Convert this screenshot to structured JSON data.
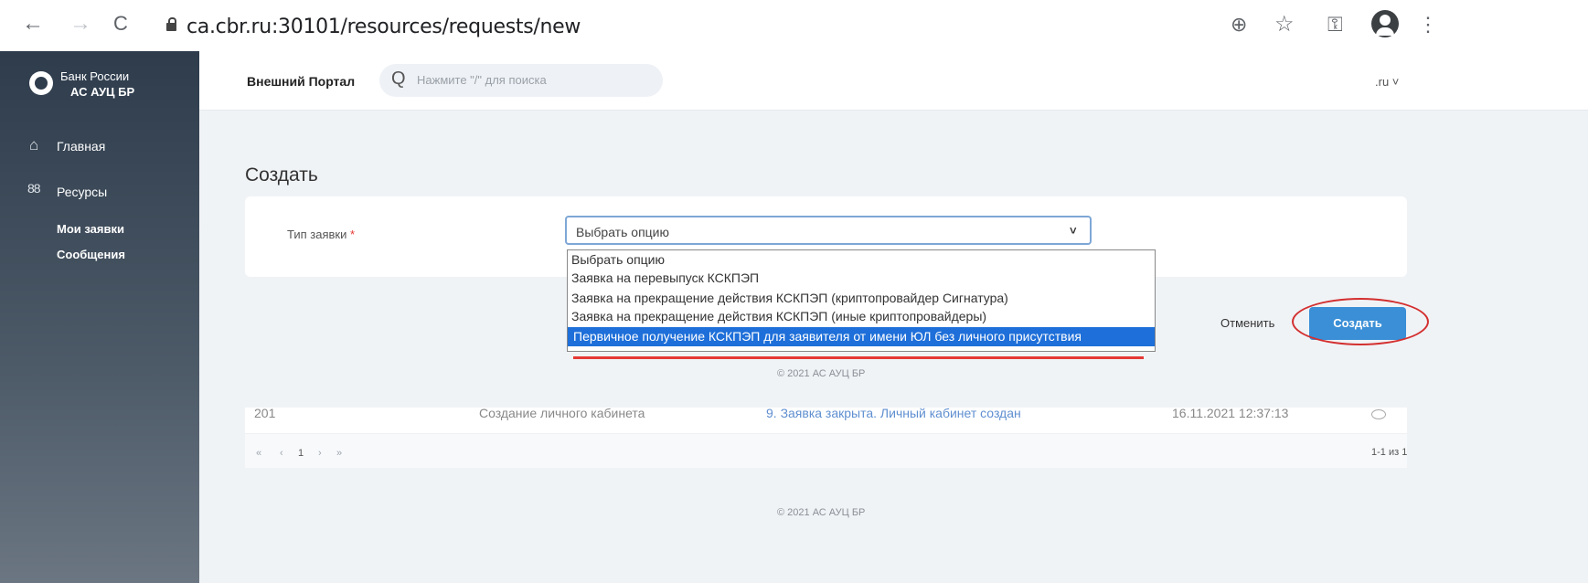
{
  "browser": {
    "url": "ca.cbr.ru:30101/resources/requests/new",
    "back_icon": "←",
    "forward_icon": "→",
    "reload_icon": "C",
    "zoom_icon": "⊕",
    "star_icon": "☆",
    "key_icon": "⚿",
    "menu_icon": "⋮"
  },
  "sidebar": {
    "logo_line1": "Банк России",
    "logo_line2": "АС АУЦ БР",
    "nav": [
      {
        "label": "Главная",
        "icon": "⌂"
      },
      {
        "label": "Ресурсы",
        "icon": "88"
      }
    ],
    "sub": [
      "Мои заявки",
      "Сообщения"
    ]
  },
  "header": {
    "portal": "Внешний Портал",
    "search_placeholder": "Нажмите \"/\" для поиска",
    "search_icon": "Q",
    "lang": ".ru ˅"
  },
  "main": {
    "title": "Создать",
    "field_label": "Тип заявки",
    "required_mark": "*",
    "select_value": "Выбрать опцию",
    "select_chevron": "˅",
    "options": [
      "Выбрать опцию",
      "Заявка на перевыпуск КСКПЭП",
      "Заявка на прекращение действия КСКПЭП (криптопровайдер Сигнатура)",
      "Заявка на прекращение действия КСКПЭП (иные криптопровайдеры)",
      "Первичное получение КСКПЭП для заявителя от имени ЮЛ без личного присутствия"
    ],
    "cancel": "Отменить",
    "create": "Создать",
    "copyright": "© 2021 АС АУЦ БР"
  },
  "table": {
    "row": [
      "201",
      "Создание личного кабинета",
      "9. Заявка закрыта. Личный кабинет создан",
      "16.11.2021 12:37:13"
    ],
    "pager": [
      "«",
      "‹",
      "1",
      "›",
      "»"
    ],
    "count": "1-1 из 1"
  },
  "footer": {
    "copyright": "© 2021 АС АУЦ БР"
  }
}
